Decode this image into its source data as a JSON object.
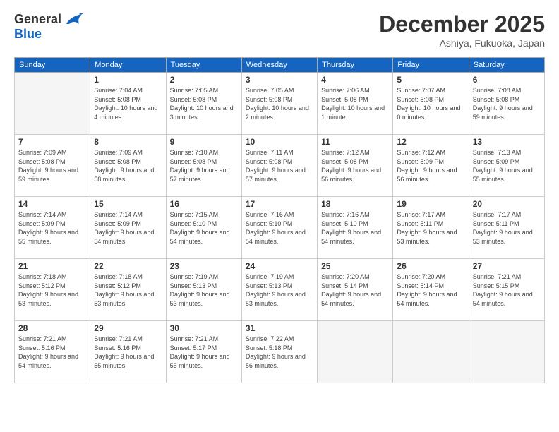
{
  "logo": {
    "general": "General",
    "blue": "Blue"
  },
  "header": {
    "month": "December 2025",
    "location": "Ashiya, Fukuoka, Japan"
  },
  "weekdays": [
    "Sunday",
    "Monday",
    "Tuesday",
    "Wednesday",
    "Thursday",
    "Friday",
    "Saturday"
  ],
  "weeks": [
    [
      {
        "day": "",
        "sunrise": "",
        "sunset": "",
        "daylight": ""
      },
      {
        "day": "1",
        "sunrise": "Sunrise: 7:04 AM",
        "sunset": "Sunset: 5:08 PM",
        "daylight": "Daylight: 10 hours and 4 minutes."
      },
      {
        "day": "2",
        "sunrise": "Sunrise: 7:05 AM",
        "sunset": "Sunset: 5:08 PM",
        "daylight": "Daylight: 10 hours and 3 minutes."
      },
      {
        "day": "3",
        "sunrise": "Sunrise: 7:05 AM",
        "sunset": "Sunset: 5:08 PM",
        "daylight": "Daylight: 10 hours and 2 minutes."
      },
      {
        "day": "4",
        "sunrise": "Sunrise: 7:06 AM",
        "sunset": "Sunset: 5:08 PM",
        "daylight": "Daylight: 10 hours and 1 minute."
      },
      {
        "day": "5",
        "sunrise": "Sunrise: 7:07 AM",
        "sunset": "Sunset: 5:08 PM",
        "daylight": "Daylight: 10 hours and 0 minutes."
      },
      {
        "day": "6",
        "sunrise": "Sunrise: 7:08 AM",
        "sunset": "Sunset: 5:08 PM",
        "daylight": "Daylight: 9 hours and 59 minutes."
      }
    ],
    [
      {
        "day": "7",
        "sunrise": "Sunrise: 7:09 AM",
        "sunset": "Sunset: 5:08 PM",
        "daylight": "Daylight: 9 hours and 59 minutes."
      },
      {
        "day": "8",
        "sunrise": "Sunrise: 7:09 AM",
        "sunset": "Sunset: 5:08 PM",
        "daylight": "Daylight: 9 hours and 58 minutes."
      },
      {
        "day": "9",
        "sunrise": "Sunrise: 7:10 AM",
        "sunset": "Sunset: 5:08 PM",
        "daylight": "Daylight: 9 hours and 57 minutes."
      },
      {
        "day": "10",
        "sunrise": "Sunrise: 7:11 AM",
        "sunset": "Sunset: 5:08 PM",
        "daylight": "Daylight: 9 hours and 57 minutes."
      },
      {
        "day": "11",
        "sunrise": "Sunrise: 7:12 AM",
        "sunset": "Sunset: 5:08 PM",
        "daylight": "Daylight: 9 hours and 56 minutes."
      },
      {
        "day": "12",
        "sunrise": "Sunrise: 7:12 AM",
        "sunset": "Sunset: 5:09 PM",
        "daylight": "Daylight: 9 hours and 56 minutes."
      },
      {
        "day": "13",
        "sunrise": "Sunrise: 7:13 AM",
        "sunset": "Sunset: 5:09 PM",
        "daylight": "Daylight: 9 hours and 55 minutes."
      }
    ],
    [
      {
        "day": "14",
        "sunrise": "Sunrise: 7:14 AM",
        "sunset": "Sunset: 5:09 PM",
        "daylight": "Daylight: 9 hours and 55 minutes."
      },
      {
        "day": "15",
        "sunrise": "Sunrise: 7:14 AM",
        "sunset": "Sunset: 5:09 PM",
        "daylight": "Daylight: 9 hours and 54 minutes."
      },
      {
        "day": "16",
        "sunrise": "Sunrise: 7:15 AM",
        "sunset": "Sunset: 5:10 PM",
        "daylight": "Daylight: 9 hours and 54 minutes."
      },
      {
        "day": "17",
        "sunrise": "Sunrise: 7:16 AM",
        "sunset": "Sunset: 5:10 PM",
        "daylight": "Daylight: 9 hours and 54 minutes."
      },
      {
        "day": "18",
        "sunrise": "Sunrise: 7:16 AM",
        "sunset": "Sunset: 5:10 PM",
        "daylight": "Daylight: 9 hours and 54 minutes."
      },
      {
        "day": "19",
        "sunrise": "Sunrise: 7:17 AM",
        "sunset": "Sunset: 5:11 PM",
        "daylight": "Daylight: 9 hours and 53 minutes."
      },
      {
        "day": "20",
        "sunrise": "Sunrise: 7:17 AM",
        "sunset": "Sunset: 5:11 PM",
        "daylight": "Daylight: 9 hours and 53 minutes."
      }
    ],
    [
      {
        "day": "21",
        "sunrise": "Sunrise: 7:18 AM",
        "sunset": "Sunset: 5:12 PM",
        "daylight": "Daylight: 9 hours and 53 minutes."
      },
      {
        "day": "22",
        "sunrise": "Sunrise: 7:18 AM",
        "sunset": "Sunset: 5:12 PM",
        "daylight": "Daylight: 9 hours and 53 minutes."
      },
      {
        "day": "23",
        "sunrise": "Sunrise: 7:19 AM",
        "sunset": "Sunset: 5:13 PM",
        "daylight": "Daylight: 9 hours and 53 minutes."
      },
      {
        "day": "24",
        "sunrise": "Sunrise: 7:19 AM",
        "sunset": "Sunset: 5:13 PM",
        "daylight": "Daylight: 9 hours and 53 minutes."
      },
      {
        "day": "25",
        "sunrise": "Sunrise: 7:20 AM",
        "sunset": "Sunset: 5:14 PM",
        "daylight": "Daylight: 9 hours and 54 minutes."
      },
      {
        "day": "26",
        "sunrise": "Sunrise: 7:20 AM",
        "sunset": "Sunset: 5:14 PM",
        "daylight": "Daylight: 9 hours and 54 minutes."
      },
      {
        "day": "27",
        "sunrise": "Sunrise: 7:21 AM",
        "sunset": "Sunset: 5:15 PM",
        "daylight": "Daylight: 9 hours and 54 minutes."
      }
    ],
    [
      {
        "day": "28",
        "sunrise": "Sunrise: 7:21 AM",
        "sunset": "Sunset: 5:16 PM",
        "daylight": "Daylight: 9 hours and 54 minutes."
      },
      {
        "day": "29",
        "sunrise": "Sunrise: 7:21 AM",
        "sunset": "Sunset: 5:16 PM",
        "daylight": "Daylight: 9 hours and 55 minutes."
      },
      {
        "day": "30",
        "sunrise": "Sunrise: 7:21 AM",
        "sunset": "Sunset: 5:17 PM",
        "daylight": "Daylight: 9 hours and 55 minutes."
      },
      {
        "day": "31",
        "sunrise": "Sunrise: 7:22 AM",
        "sunset": "Sunset: 5:18 PM",
        "daylight": "Daylight: 9 hours and 56 minutes."
      },
      {
        "day": "",
        "sunrise": "",
        "sunset": "",
        "daylight": ""
      },
      {
        "day": "",
        "sunrise": "",
        "sunset": "",
        "daylight": ""
      },
      {
        "day": "",
        "sunrise": "",
        "sunset": "",
        "daylight": ""
      }
    ]
  ]
}
